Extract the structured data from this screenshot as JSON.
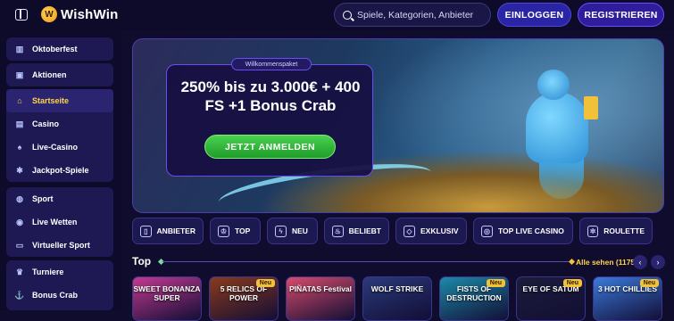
{
  "header": {
    "logo_text": "WishWin",
    "search_placeholder": "Spiele, Kategorien, Anbieter",
    "login_label": "EINLOGGEN",
    "register_label": "REGISTRIEREN"
  },
  "sidebar": {
    "groups": [
      {
        "items": [
          {
            "label": "Oktoberfest",
            "icon": "building-icon"
          }
        ]
      },
      {
        "items": [
          {
            "label": "Aktionen",
            "icon": "gift-icon"
          }
        ]
      },
      {
        "items": [
          {
            "label": "Startseite",
            "icon": "home-icon",
            "active": true
          },
          {
            "label": "Casino",
            "icon": "slot-icon"
          },
          {
            "label": "Live-Casino",
            "icon": "cards-icon"
          },
          {
            "label": "Jackpot-Spiele",
            "icon": "jackpot-icon"
          }
        ]
      },
      {
        "items": [
          {
            "label": "Sport",
            "icon": "ball-icon"
          },
          {
            "label": "Live Wetten",
            "icon": "live-icon"
          },
          {
            "label": "Virtueller Sport",
            "icon": "monitor-icon"
          }
        ]
      },
      {
        "items": [
          {
            "label": "Turniere",
            "icon": "trophy-icon"
          },
          {
            "label": "Bonus Crab",
            "icon": "claw-icon"
          }
        ]
      }
    ]
  },
  "hero": {
    "tag": "Willkommenspaket",
    "headline_line1": "250% bis zu 3.000€ + 400",
    "headline_line2": "FS +1 Bonus Crab",
    "cta_label": "JETZT ANMELDEN"
  },
  "categories": [
    {
      "label": "ANBIETER",
      "icon": "provider-icon"
    },
    {
      "label": "TOP",
      "icon": "crown-icon"
    },
    {
      "label": "NEU",
      "icon": "lightning-icon"
    },
    {
      "label": "BELIEBT",
      "icon": "fire-icon"
    },
    {
      "label": "EXKLUSIV",
      "icon": "diamond-icon"
    },
    {
      "label": "TOP LIVE CASINO",
      "icon": "chip-icon"
    },
    {
      "label": "ROULETTE",
      "icon": "roulette-icon"
    }
  ],
  "top_section": {
    "title": "Top",
    "see_all_label": "Alle sehen (1175)",
    "prev_arrow": "‹",
    "next_arrow": "›"
  },
  "games": [
    {
      "name": "SWEET BONANZA SUPER",
      "new_badge": "",
      "color": "#c23a8e"
    },
    {
      "name": "5 RELICS OF POWER",
      "new_badge": "Neu",
      "color": "#8a3a1c"
    },
    {
      "name": "PIÑATAS Festival",
      "new_badge": "",
      "color": "#d84b6b"
    },
    {
      "name": "WOLF STRIKE",
      "new_badge": "",
      "color": "#2a3a7a"
    },
    {
      "name": "FISTS OF DESTRUCTION",
      "new_badge": "Neu",
      "color": "#1c8aa8"
    },
    {
      "name": "EYE OF SATUM",
      "new_badge": "Neu",
      "color": "#1c1c3a"
    },
    {
      "name": "3 HOT CHILLIES",
      "new_badge": "Neu",
      "color": "#3a7adc"
    }
  ]
}
